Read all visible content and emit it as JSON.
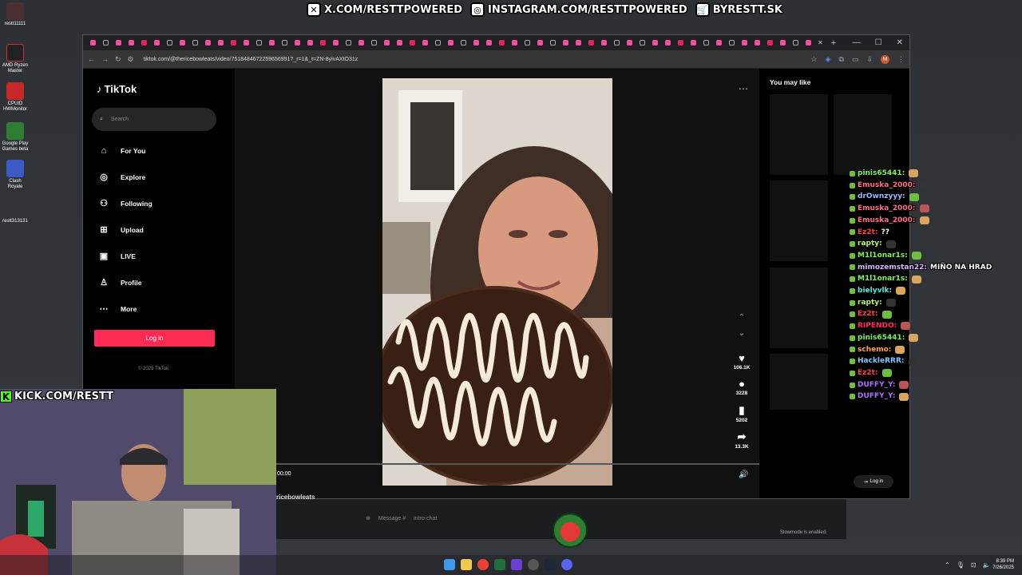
{
  "desktop": {
    "icons": [
      {
        "label": "restt11111"
      },
      {
        "label": "AMD Ryzen Master"
      },
      {
        "label": "CPUID HWMonitor"
      },
      {
        "label": "Google Play Games beta"
      },
      {
        "label": "Clash Royale"
      },
      {
        "label": "restt313131"
      }
    ]
  },
  "overlay": {
    "x_link": "X.COM/RESTTPOWERED",
    "instagram_link": "INSTAGRAM.COM/RESTTPOWERED",
    "shop_link": "BYRESTT.SK",
    "kick_link": "KICK.COM/RESTT"
  },
  "browser": {
    "url": "tiktok.com/@thericebowleats/video/7518484672259656991?_r=1&_t=ZN-8yivAXtO31z"
  },
  "tiktok": {
    "logo": "TikTok",
    "search_placeholder": "Search",
    "nav": {
      "for_you": "For You",
      "explore": "Explore",
      "following": "Following",
      "upload": "Upload",
      "live": "LIVE",
      "profile": "Profile",
      "more": "More"
    },
    "login_label": "Log in",
    "copyright": "© 2025 TikTok",
    "time": "00:00",
    "likes": "106.1K",
    "comments": "3228",
    "saves": "5202",
    "shares": "13.3K",
    "you_may_like": "You may like",
    "rec_login": "Log in"
  },
  "chat": [
    {
      "user": "pinis65441:",
      "color": "#7cf45a",
      "msg": ""
    },
    {
      "user": "Emuska_2000:",
      "color": "#ff6b81",
      "msg": ""
    },
    {
      "user": "drOwnzyyy:",
      "color": "#9ab8ff",
      "msg": ""
    },
    {
      "user": "Emuska_2000:",
      "color": "#ff6b81",
      "msg": ""
    },
    {
      "user": "Emuska_2000:",
      "color": "#ff6b81",
      "msg": ""
    },
    {
      "user": "Ez2t:",
      "color": "#ff4040",
      "msg": "??"
    },
    {
      "user": "rapty:",
      "color": "#b9f56a",
      "msg": ""
    },
    {
      "user": "M1l1onar1s:",
      "color": "#7cf45a",
      "msg": ""
    },
    {
      "user": "mimozemstan22:",
      "color": "#d9b3ff",
      "msg": "MIÑO NA HRAD"
    },
    {
      "user": "M1l1onar1s:",
      "color": "#7cf45a",
      "msg": ""
    },
    {
      "user": "bielyvlk:",
      "color": "#4de6e0",
      "msg": ""
    },
    {
      "user": "rapty:",
      "color": "#b9f56a",
      "msg": ""
    },
    {
      "user": "Ez2t:",
      "color": "#ff4040",
      "msg": ""
    },
    {
      "user": "RIPENDO:",
      "color": "#ff2d55",
      "msg": ""
    },
    {
      "user": "pinis65441:",
      "color": "#7cf45a",
      "msg": ""
    },
    {
      "user": "schemo:",
      "color": "#ffa14a",
      "msg": ""
    },
    {
      "user": "HackleRRR:",
      "color": "#7ec8ff",
      "msg": ""
    },
    {
      "user": "Ez2t:",
      "color": "#ff4040",
      "msg": ""
    },
    {
      "user": "DUFFY_Y:",
      "color": "#b06bff",
      "msg": ""
    },
    {
      "user": "DUFFY_Y:",
      "color": "#b06bff",
      "msg": ""
    }
  ],
  "kick": {
    "channel": "ricebowleats",
    "input_placeholder": "Message #",
    "input_suffix": "intro-chat",
    "slowmode": "Slowmode is enabled."
  },
  "clock": {
    "time": "8:39 PM",
    "date": "7/26/2025"
  }
}
